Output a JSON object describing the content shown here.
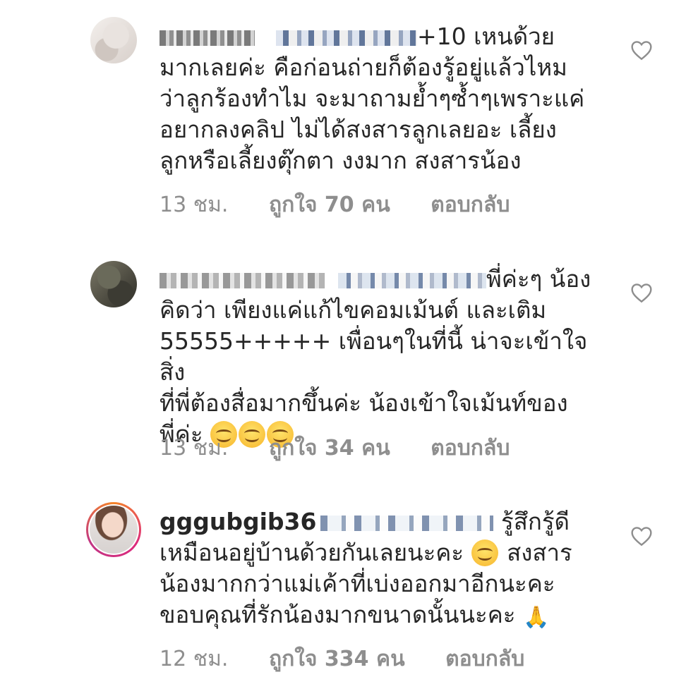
{
  "comments": [
    {
      "username": "",
      "text": "+10 เหนด้วย\nมากเลยค่ะ คือก่อนถ่ายก็ต้องรู้อยู่แล้วไหม\nว่าลูกร้องทำไม จะมาถามย้ำๆซ้ำๆเพราะแค่\nอยากลงคลิป ไม่ได้สงสารลูกเลยอะ เลี้ยง\nลูกหรือเลี้ยงตุ๊กตา งงมาก สงสารน้อง",
      "time": "13 ชม.",
      "likes": "ถูกใจ 70 คน",
      "reply": "ตอบกลับ"
    },
    {
      "username": "",
      "text": "พี่ค่ะๆ น้อง\nคิดว่า เพียงแค่แก้ไขคอมเม้นต์ และเติม\n55555+++++ เพื่อนๆในที่นี้ น่าจะเข้าใจสิ่ง\nที่พี่ต้องสื่อมากขึ้นค่ะ น้องเข้าใจเม้นท์ของ\nพี่ค่ะ",
      "time": "13 ชม.",
      "likes": "ถูกใจ 34 คน",
      "reply": "ตอบกลับ"
    },
    {
      "username": "gggubgib36",
      "text_line1": "รู้สึกรู้ดี",
      "text_line2a": "เหมือนอยู่บ้านด้วยกันเลยนะคะ",
      "text_line2b": "สงสาร",
      "text_line3": "น้องมากกว่าแม่เค้าที่เบ่งออกมาอีกนะคะ",
      "text_line4": "ขอบคุณที่รักน้องมากขนาดนั้นนะคะ",
      "time": "12 ชม.",
      "likes": "ถูกใจ 334 คน",
      "reply": "ตอบกลับ"
    }
  ],
  "icons": {
    "heart": "heart-outline-icon",
    "smile": "smiling-face-emoji",
    "pray": "folded-hands-emoji"
  },
  "colors": {
    "text": "#262626",
    "meta": "#8e8e8e",
    "story_ring": "#dd2a7b"
  }
}
